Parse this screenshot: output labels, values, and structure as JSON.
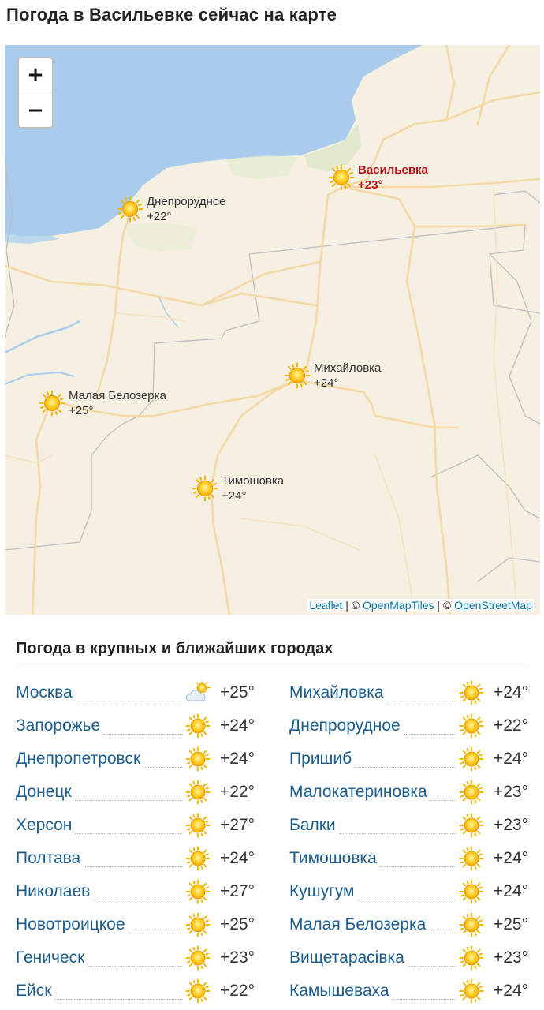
{
  "page_title": "Погода в Васильевке сейчас на карте",
  "map": {
    "zoom_in": "+",
    "zoom_out": "−",
    "markers": [
      {
        "city": "Васильевка",
        "temp": "+23°",
        "icon": "sun-icon",
        "current": true
      },
      {
        "city": "Днепрорудное",
        "temp": "+22°",
        "icon": "sun-icon",
        "current": false
      },
      {
        "city": "Михайловка",
        "temp": "+24°",
        "icon": "sun-icon",
        "current": false
      },
      {
        "city": "Малая Белозерка",
        "temp": "+25°",
        "icon": "sun-icon",
        "current": false
      },
      {
        "city": "Тимошовка",
        "temp": "+24°",
        "icon": "sun-icon",
        "current": false
      }
    ],
    "attribution": {
      "leaflet": "Leaflet",
      "sep1": " | © ",
      "openmaptiles": "OpenMapTiles",
      "sep2": " | © ",
      "osm": "OpenStreetMap"
    },
    "colors": {
      "water": "#a9ccec",
      "land": "#f6f0e3",
      "road": "#f3d9a6",
      "border": "#bdbdbd",
      "current_city": "#b5121b"
    }
  },
  "nearby": {
    "title": "Погода в крупных и ближайших городах",
    "left": [
      {
        "city": "Москва",
        "temp": "+25°",
        "icon": "partly-cloudy-icon"
      },
      {
        "city": "Запорожье",
        "temp": "+24°",
        "icon": "sun-icon"
      },
      {
        "city": "Днепропетровск",
        "temp": "+24°",
        "icon": "sun-icon"
      },
      {
        "city": "Донецк",
        "temp": "+22°",
        "icon": "sun-icon"
      },
      {
        "city": "Херсон",
        "temp": "+27°",
        "icon": "sun-icon"
      },
      {
        "city": "Полтава",
        "temp": "+24°",
        "icon": "sun-icon"
      },
      {
        "city": "Николаев",
        "temp": "+27°",
        "icon": "sun-icon"
      },
      {
        "city": "Новотроицкое",
        "temp": "+25°",
        "icon": "sun-icon"
      },
      {
        "city": "Геническ",
        "temp": "+23°",
        "icon": "sun-icon"
      },
      {
        "city": "Ейск",
        "temp": "+22°",
        "icon": "sun-icon"
      }
    ],
    "right": [
      {
        "city": "Михайловка",
        "temp": "+24°",
        "icon": "sun-icon"
      },
      {
        "city": "Днепрорудное",
        "temp": "+22°",
        "icon": "sun-icon"
      },
      {
        "city": "Пришиб",
        "temp": "+24°",
        "icon": "sun-icon"
      },
      {
        "city": "Малокатериновка",
        "temp": "+23°",
        "icon": "sun-icon"
      },
      {
        "city": "Балки",
        "temp": "+23°",
        "icon": "sun-icon"
      },
      {
        "city": "Тимошовка",
        "temp": "+24°",
        "icon": "sun-icon"
      },
      {
        "city": "Кушугум",
        "temp": "+24°",
        "icon": "sun-icon"
      },
      {
        "city": "Малая Белозерка",
        "temp": "+25°",
        "icon": "sun-icon"
      },
      {
        "city": "Вищетарасівка",
        "temp": "+23°",
        "icon": "sun-icon"
      },
      {
        "city": "Камышеваха",
        "temp": "+24°",
        "icon": "sun-icon"
      }
    ]
  }
}
